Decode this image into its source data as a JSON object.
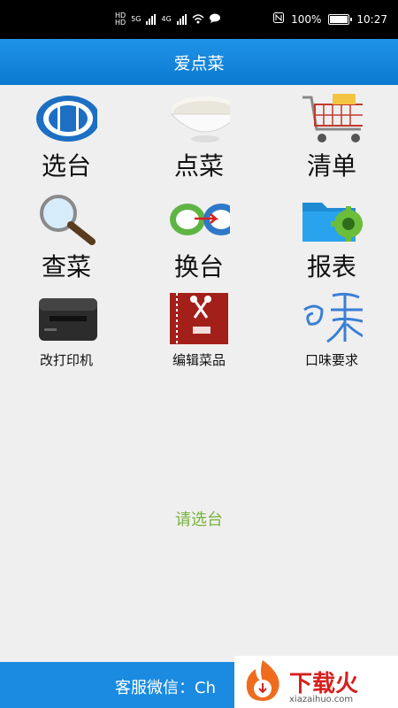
{
  "status_bar": {
    "battery": "100%",
    "time": "10:27",
    "net_5g": "5G",
    "net_4g": "4G"
  },
  "header": {
    "title": "爱点菜"
  },
  "menu": {
    "select_table": "选台",
    "order_dishes": "点菜",
    "order_list": "清单",
    "search_dishes": "查菜",
    "change_table": "换台",
    "reports": "报表",
    "change_printer": "改打印机",
    "edit_dishes": "编辑菜品",
    "taste_requirements": "口味要求"
  },
  "prompt": "请选台",
  "footer": {
    "service_wechat": "客服微信：Ch"
  },
  "watermark": {
    "brand": "下载火",
    "site": "xiazaihuo.com"
  },
  "colors": {
    "header_blue": "#1a8be0",
    "prompt_green": "#77b33b"
  }
}
